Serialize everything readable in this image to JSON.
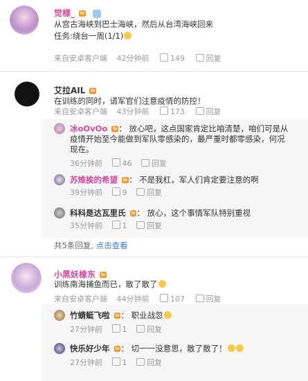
{
  "posts": [
    {
      "user": "觉様_",
      "user_color": "#d04a9b",
      "level": "lv",
      "text_lines": [
        "从宫古海峡到巴士海峡，然后从台湾海峡回来",
        "任务:绕台一周(1/1)"
      ],
      "source": "来自安卓客户端",
      "time": "42分钟前",
      "likes": "149",
      "reply_label": "回复"
    },
    {
      "user": "艾拉AIL",
      "user_color": "#333333",
      "level": "lv",
      "text_lines": [
        "在训练的同时，请军官们注意疫情的防控！"
      ],
      "source": "来自安卓客户端",
      "time": "43分钟前",
      "likes": "173",
      "reply_label": "回复",
      "subreplies": [
        {
          "user": "冰oOvOo",
          "user_color": "#d04a9b",
          "text_lines": [
            "：  放心吧，这点国家肯定比咱清楚，咱们可是从",
            "疫情开始至今能做到军队零感染的，最严重时都零感染，何况",
            "现在。"
          ],
          "time": "36分钟前",
          "likes": "46",
          "reply_label": "回复"
        },
        {
          "user": "苏雉挨的希望",
          "user_color": "#d04a9b",
          "text_lines": [
            "：  不是我杠，军人们肯定要注意的啊"
          ],
          "time": "39分钟前",
          "likes": "9",
          "reply_label": "回复"
        },
        {
          "user": "科科是达瓦里氏",
          "user_color": "#333333",
          "text_lines": [
            "：  放心，这个事情军队特别重视"
          ],
          "time": "35分钟前",
          "likes": "1",
          "reply_label": "回复"
        }
      ],
      "more_text": "共5条回复,",
      "more_link": "点击查看"
    },
    {
      "user": "小黑妖橡东",
      "user_color": "#d04a9b",
      "level": "lv",
      "text_lines": [
        "训练南海捕鱼而已，散了散了"
      ],
      "source": "来自安卓客户端",
      "time": "44分钟前",
      "likes": "107",
      "reply_label": "回复",
      "subreplies": [
        {
          "user": "竹蜻蜓飞啦",
          "user_color": "#333333",
          "text_lines": [
            "：  职业战忽"
          ],
          "time": "27分钟前",
          "likes": "1",
          "reply_label": "回复"
        },
        {
          "user": "快乐好少年",
          "user_color": "#333333",
          "text_lines": [
            "：  切一一没意思，散了散了！"
          ],
          "time": "27分钟前",
          "likes": "1",
          "reply_label": "回复"
        }
      ]
    }
  ]
}
